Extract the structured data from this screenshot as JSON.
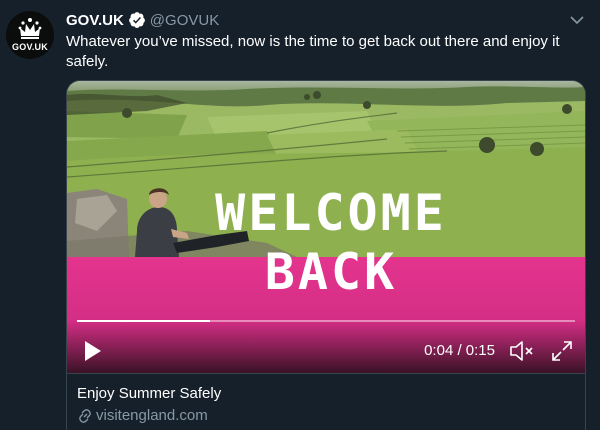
{
  "account": {
    "avatar_text": "GOV.UK",
    "display_name": "GOV.UK",
    "handle": "@GOVUK",
    "verified": true
  },
  "tweet": {
    "text": "Whatever you’ve missed, now is the time to get back out there and enjoy it safely."
  },
  "video": {
    "overlay_line1": "WELCOME",
    "overlay_line2": "BACK",
    "current_time": "0:04",
    "duration": "0:15",
    "time_display": "0:04 / 0:15",
    "progress_fraction": 0.2667,
    "muted": true
  },
  "card": {
    "title": "Enjoy Summer Safely",
    "domain": "visitengland.com"
  },
  "colors": {
    "background": "#15202b",
    "secondary_text": "#8899a6",
    "border": "#38444d",
    "verified_badge": "#ffffff",
    "banner_pink": "#e4348e"
  },
  "icons": {
    "verified": "verified-badge-icon",
    "caret": "chevron-down-icon",
    "play": "play-icon",
    "mute": "speaker-muted-icon",
    "fullscreen": "fullscreen-icon",
    "link": "link-icon",
    "crown": "crown-icon"
  }
}
